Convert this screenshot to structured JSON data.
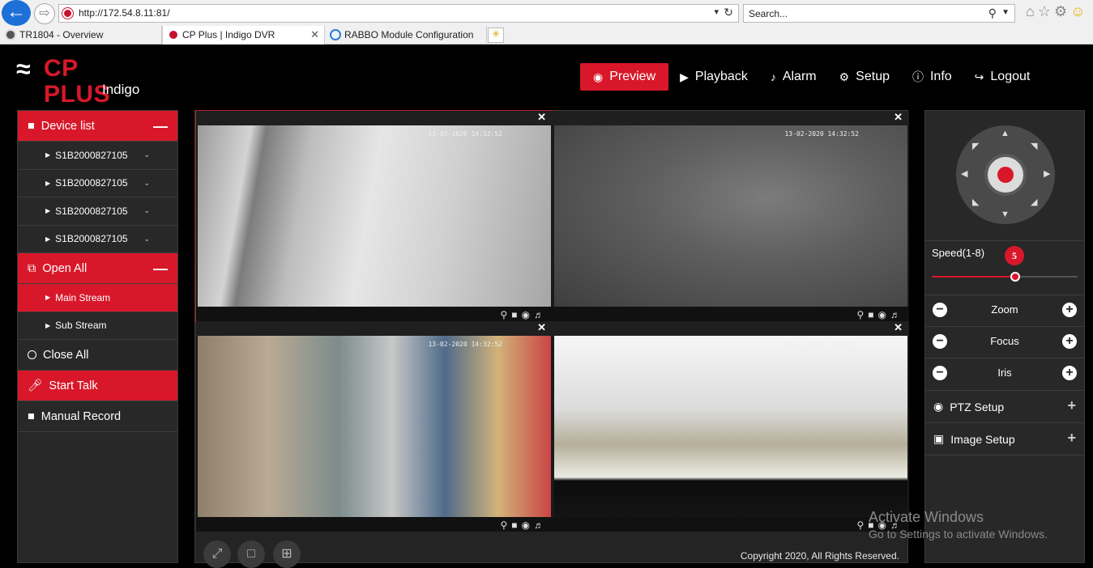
{
  "browser": {
    "url": "http://172.54.8.11:81/",
    "search_placeholder": "Search...",
    "tabs": [
      {
        "label": "TR1804 - Overview"
      },
      {
        "label": "CP Plus | Indigo DVR"
      },
      {
        "label": "RABBO Module Configuration"
      }
    ]
  },
  "header": {
    "logo_text": "CP PLUS",
    "logo_sub": "Indigo",
    "nav": {
      "preview": "Preview",
      "playback": "Playback",
      "alarm": "Alarm",
      "setup": "Setup",
      "info": "Info",
      "logout": "Logout"
    }
  },
  "sidebar": {
    "device_list": "Device list",
    "devices": [
      "S1B2000827105",
      "S1B2000827105",
      "S1B2000827105",
      "S1B2000827105"
    ],
    "open_all": "Open All",
    "main_stream": "Main Stream",
    "sub_stream": "Sub Stream",
    "close_all": "Close All",
    "start_talk": "Start Talk",
    "manual_record": "Manual Record"
  },
  "grid": {
    "timestamps": [
      "13-02-2020 14:32:52",
      "13-02-2020 14:32:52",
      "13-02-2020 14:32:52",
      "13-02-2020 14:32:52"
    ],
    "copyright": "Copyright 2020, All Rights Reserved."
  },
  "ptz": {
    "speed_label": "Speed(1-8)",
    "speed_value": "5",
    "speed_fraction": 0.57,
    "zoom": "Zoom",
    "focus": "Focus",
    "iris": "Iris",
    "ptz_setup": "PTZ Setup",
    "image_setup": "Image Setup"
  },
  "watermark": {
    "line1": "Activate Windows",
    "line2": "Go to Settings to activate Windows."
  },
  "colors": {
    "accent": "#d8182a",
    "panel": "#282828"
  }
}
